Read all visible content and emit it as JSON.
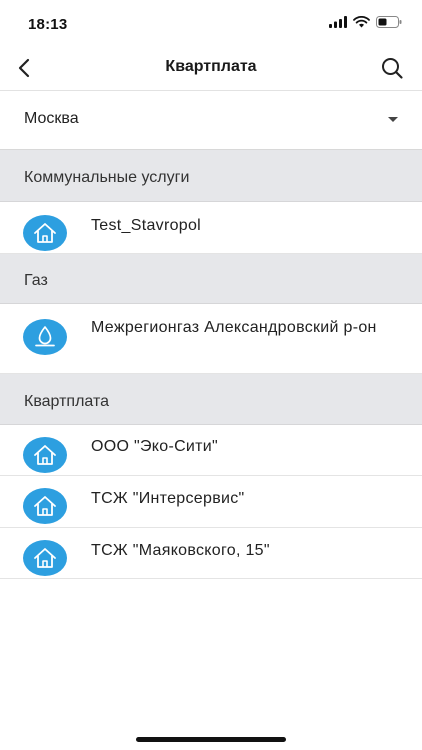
{
  "status_bar": {
    "time": "18:13"
  },
  "nav": {
    "title": "Квартплата",
    "back_icon": "chevron-left-icon",
    "search_icon": "search-icon"
  },
  "city_select": {
    "value": "Москва"
  },
  "sections": [
    {
      "title": "Коммунальные услуги",
      "items": [
        {
          "label": "Test_Stavropol",
          "icon": "house-icon"
        }
      ]
    },
    {
      "title": "Газ",
      "items": [
        {
          "label": "Межрегионгаз Александровский р-он",
          "icon": "gas-flame-icon"
        }
      ]
    },
    {
      "title": "Квартплата",
      "items": [
        {
          "label": "ООО \"Эко-Сити\"",
          "icon": "house-icon"
        },
        {
          "label": "ТСЖ \"Интерсервис\"",
          "icon": "house-icon"
        },
        {
          "label": "ТСЖ \"Маяковского, 15\"",
          "icon": "house-icon"
        }
      ]
    }
  ],
  "colors": {
    "accent": "#2d9fe0",
    "section_bg": "#e6e7ea"
  }
}
